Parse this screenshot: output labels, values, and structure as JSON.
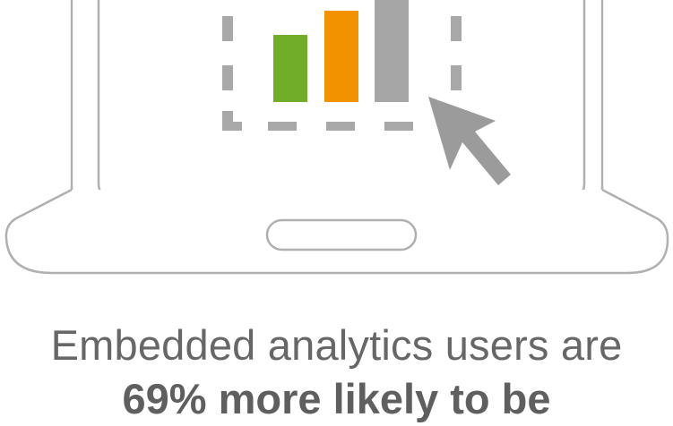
{
  "caption": {
    "line1": "Embedded analytics users are",
    "line2": "69% more likely to be"
  },
  "icon": {
    "name": "laptop-with-bar-chart-icon",
    "bar_colors": [
      "#72ad2a",
      "#f39200",
      "#a6a6a6"
    ],
    "outline_color": "#a8a8a8",
    "cursor_color": "#9b9b9b"
  }
}
